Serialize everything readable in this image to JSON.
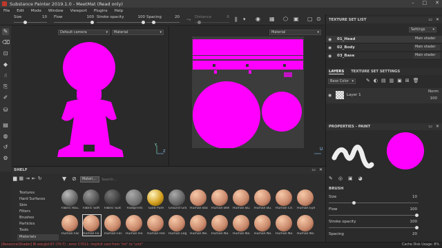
{
  "app": {
    "title": "Substance Painter 2019.1.0 - MeetMat (Read only)"
  },
  "menu": [
    "File",
    "Edit",
    "Mode",
    "Window",
    "Viewport",
    "Plugins",
    "Help"
  ],
  "toolbar": {
    "size_label": "Size",
    "size_value": "10",
    "flow_label": "Flow",
    "flow_value": "100",
    "stroke_label": "Stroke opacity",
    "stroke_value": "100",
    "spacing_label": "Spacing",
    "spacing_value": "20",
    "distance_label": "Distance",
    "distance_value": "8"
  },
  "viewport3d": {
    "camera": "Default camera",
    "mode": "Material"
  },
  "viewport2d": {
    "mode": "Material"
  },
  "accent": "#ff00ff",
  "shelf": {
    "title": "SHELF",
    "filter_tag": "Materi...",
    "search_placeholder": "Search...",
    "categories": [
      "Textures",
      "Hard Surfaces",
      "Skin",
      "Filters",
      "Brushes",
      "Particles",
      "Tools",
      "Materials"
    ],
    "materials_row1": [
      "Fabric Rou...",
      "Fabric Soft ...",
      "Fabric Suit ...",
      "Footprints",
      "Gold Pure",
      "Ground Gra...",
      "Human Bac...",
      "Human Bell...",
      "Human Bu...",
      "Human Bu...",
      "Human Ch...",
      "Human Eye..."
    ],
    "materials_row2": [
      "Human Fac...",
      "Human Fa...",
      "Human For...",
      "Human He...",
      "Human Hea...",
      "Human Leg...",
      "Human Ne...",
      "Human No...",
      "Human No...",
      "Human No...",
      "Human No...",
      "Human No..."
    ]
  },
  "texture_set_list": {
    "title": "TEXTURE SET LIST",
    "settings": "Settings",
    "sets": [
      {
        "name": "01_Head",
        "shader": "Main shader"
      },
      {
        "name": "02_Body",
        "shader": "Main shader"
      },
      {
        "name": "03_Base",
        "shader": "Main shader"
      }
    ]
  },
  "layers": {
    "tab1": "LAYERS",
    "tab2": "TEXTURE SET SETTINGS",
    "channel": "Base Color",
    "layer_name": "Layer 1",
    "blend": "Norm",
    "opacity": "100"
  },
  "properties": {
    "title": "PROPERTIES - PAINT",
    "brush_label": "BRUSH",
    "size_label": "Size",
    "size_value": "10",
    "flow_label": "Flow",
    "flow_value": "100",
    "stroke_label": "Stroke opacity",
    "stroke_value": "100",
    "spacing_label": "Spacing",
    "spacing_value": "20"
  },
  "status": {
    "error": "[Resource\\Shader] Bi·ww.glsl:67 (70:7) : error C7011: implicit cast from \"int\" to \"uint\"",
    "cache": "Cache Disk Usage: 8%"
  }
}
